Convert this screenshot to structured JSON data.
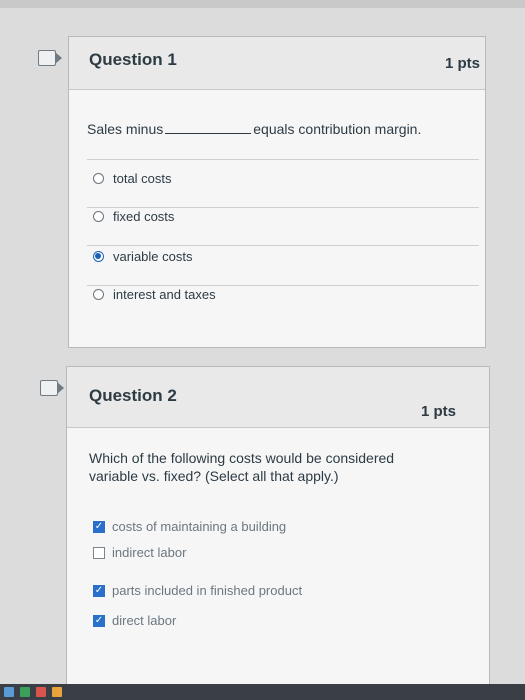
{
  "q1": {
    "title": "Question 1",
    "points": "1 pts",
    "prompt_before": "Sales minus",
    "prompt_after": "equals contribution margin.",
    "answers": [
      {
        "label": "total costs",
        "selected": false
      },
      {
        "label": "fixed costs",
        "selected": false
      },
      {
        "label": "variable costs",
        "selected": true
      },
      {
        "label": "interest and taxes",
        "selected": false
      }
    ]
  },
  "q2": {
    "title": "Question 2",
    "points": "1 pts",
    "prompt_line1": "Which of the following costs would be considered",
    "prompt_line2": "variable vs. fixed? (Select all that apply.)",
    "answers": [
      {
        "label": "costs of maintaining a building",
        "checked": true
      },
      {
        "label": "indirect labor",
        "checked": false
      },
      {
        "label": "parts included in finished product",
        "checked": true
      },
      {
        "label": "direct labor",
        "checked": true
      }
    ]
  },
  "colors": {
    "accent": "#1d5fb5",
    "checkbox": "#2a6fc9"
  },
  "icons": [
    "flag-question-icon",
    "radio-icon",
    "checkbox-icon"
  ]
}
